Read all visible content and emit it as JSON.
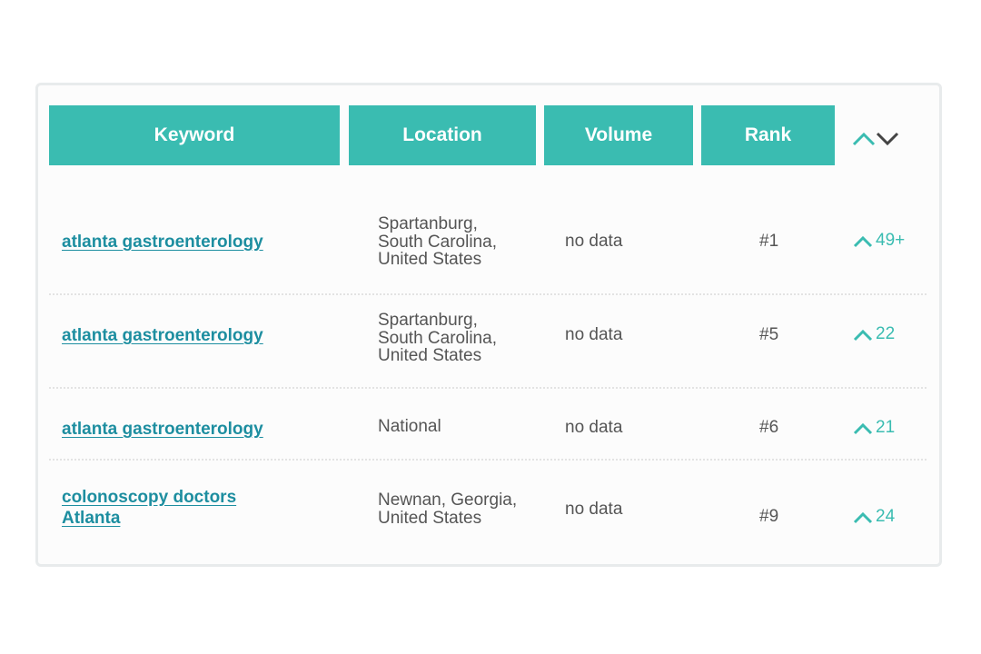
{
  "colors": {
    "header_bg": "#3abcb1",
    "header_text": "#ffffff",
    "link": "#1d8ea0",
    "body_text": "#555555",
    "positive_change": "#3abcb1",
    "sort_inactive": "#444444"
  },
  "table": {
    "headers": {
      "keyword": "Keyword",
      "location": "Location",
      "volume": "Volume",
      "rank": "Rank"
    },
    "sort_control": {
      "up_icon": "chevron-up-icon",
      "down_icon": "chevron-down-icon",
      "active": "up"
    },
    "rows": [
      {
        "keyword": "atlanta gastroenterology",
        "location_lines": [
          "Spartanburg,",
          "South Carolina,",
          "United States"
        ],
        "volume": "no data",
        "rank": "#1",
        "change_icon": "chevron-up-icon",
        "change": "49+"
      },
      {
        "keyword": "atlanta gastroenterology",
        "location_lines": [
          "Spartanburg,",
          "South Carolina,",
          "United States"
        ],
        "volume": "no data",
        "rank": "#5",
        "change_icon": "chevron-up-icon",
        "change": "22"
      },
      {
        "keyword": "atlanta gastroenterology",
        "location_lines": [
          "National"
        ],
        "volume": "no data",
        "rank": "#6",
        "change_icon": "chevron-up-icon",
        "change": "21"
      },
      {
        "keyword_lines": [
          "colonoscopy doctors",
          "Atlanta"
        ],
        "location_lines": [
          "Newnan, Georgia,",
          "United States"
        ],
        "volume": "no data",
        "rank": "#9",
        "change_icon": "chevron-up-icon",
        "change": "24"
      }
    ]
  }
}
